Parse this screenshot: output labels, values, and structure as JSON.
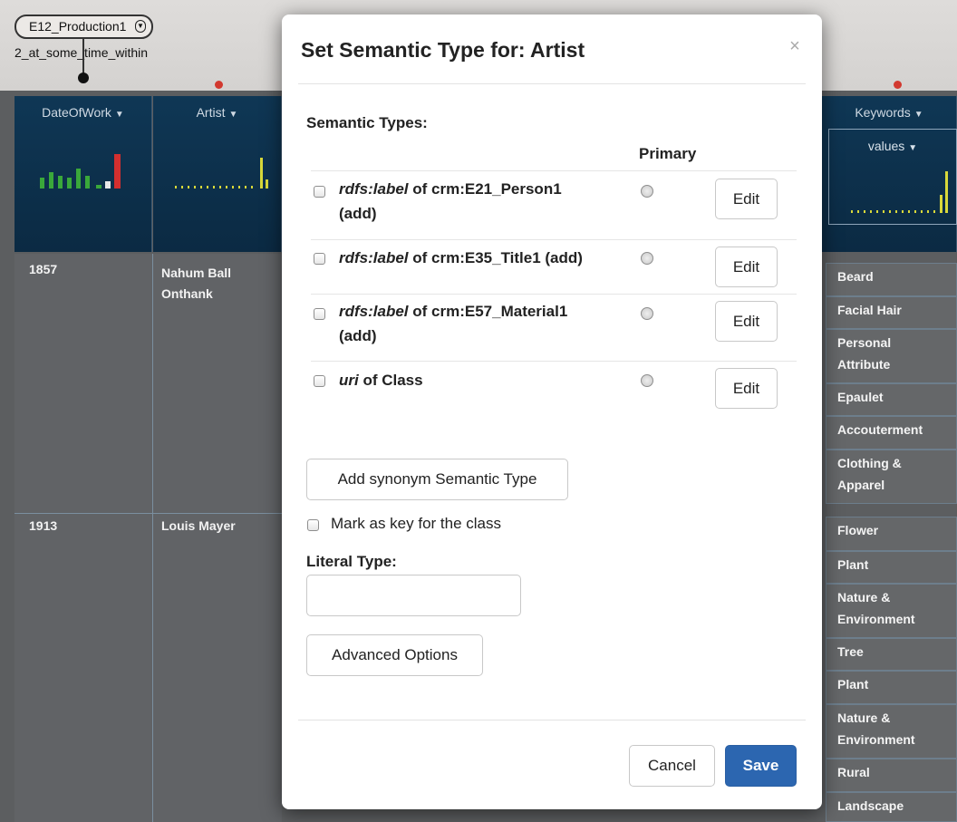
{
  "workspace": {
    "node_label": "E12_Production1",
    "link_label": "2_at_some_time_within",
    "columns": [
      {
        "title": "DateOfWork"
      },
      {
        "title": "Artist"
      },
      {
        "title": "Keywords"
      }
    ],
    "values_label": "values",
    "rows": [
      {
        "date": "1857",
        "artist_line1": "Nahum Ball",
        "artist_line2": "Onthank"
      },
      {
        "date": "1913",
        "artist_line1": "Louis Mayer",
        "artist_line2": ""
      }
    ],
    "keywords_group1": [
      "Beard",
      "Facial Hair",
      "Personal Attribute",
      "Epaulet",
      "Accouterment",
      "Clothing & Apparel"
    ],
    "keywords_group2": [
      "Flower",
      "Plant",
      "Nature & Environment",
      "Tree",
      "Plant",
      "Nature & Environment",
      "Rural",
      "Landscape"
    ],
    "colors": {
      "header_bg": "#0f3755",
      "spark_green": "#3aa83a",
      "spark_red": "#d32f2f",
      "spark_yellow": "#d8d83a",
      "red_dot": "#d2392f"
    }
  },
  "modal": {
    "title": "Set Semantic Type for: Artist",
    "close_glyph": "×",
    "semantic_types_label": "Semantic Types:",
    "primary_header": "Primary",
    "types": [
      {
        "property": "rdfs:label",
        "of_text": " of crm:E21_Person1",
        "line2": "(add)",
        "edit_label": "Edit"
      },
      {
        "property": "rdfs:label",
        "of_text": " of crm:E35_Title1 (add)",
        "line2": "",
        "edit_label": "Edit"
      },
      {
        "property": "rdfs:label",
        "of_text": " of crm:E57_Material1",
        "line2": "(add)",
        "edit_label": "Edit"
      },
      {
        "property": "uri",
        "of_text": " of Class",
        "line2": "",
        "edit_label": "Edit"
      }
    ],
    "add_synonym_label": "Add synonym Semantic Type",
    "mark_key_label": "Mark as key for the class",
    "literal_type_label": "Literal Type:",
    "literal_type_value": "",
    "advanced_options_label": "Advanced Options",
    "cancel_label": "Cancel",
    "save_label": "Save",
    "colors": {
      "save_button": "#2c66b0"
    }
  }
}
